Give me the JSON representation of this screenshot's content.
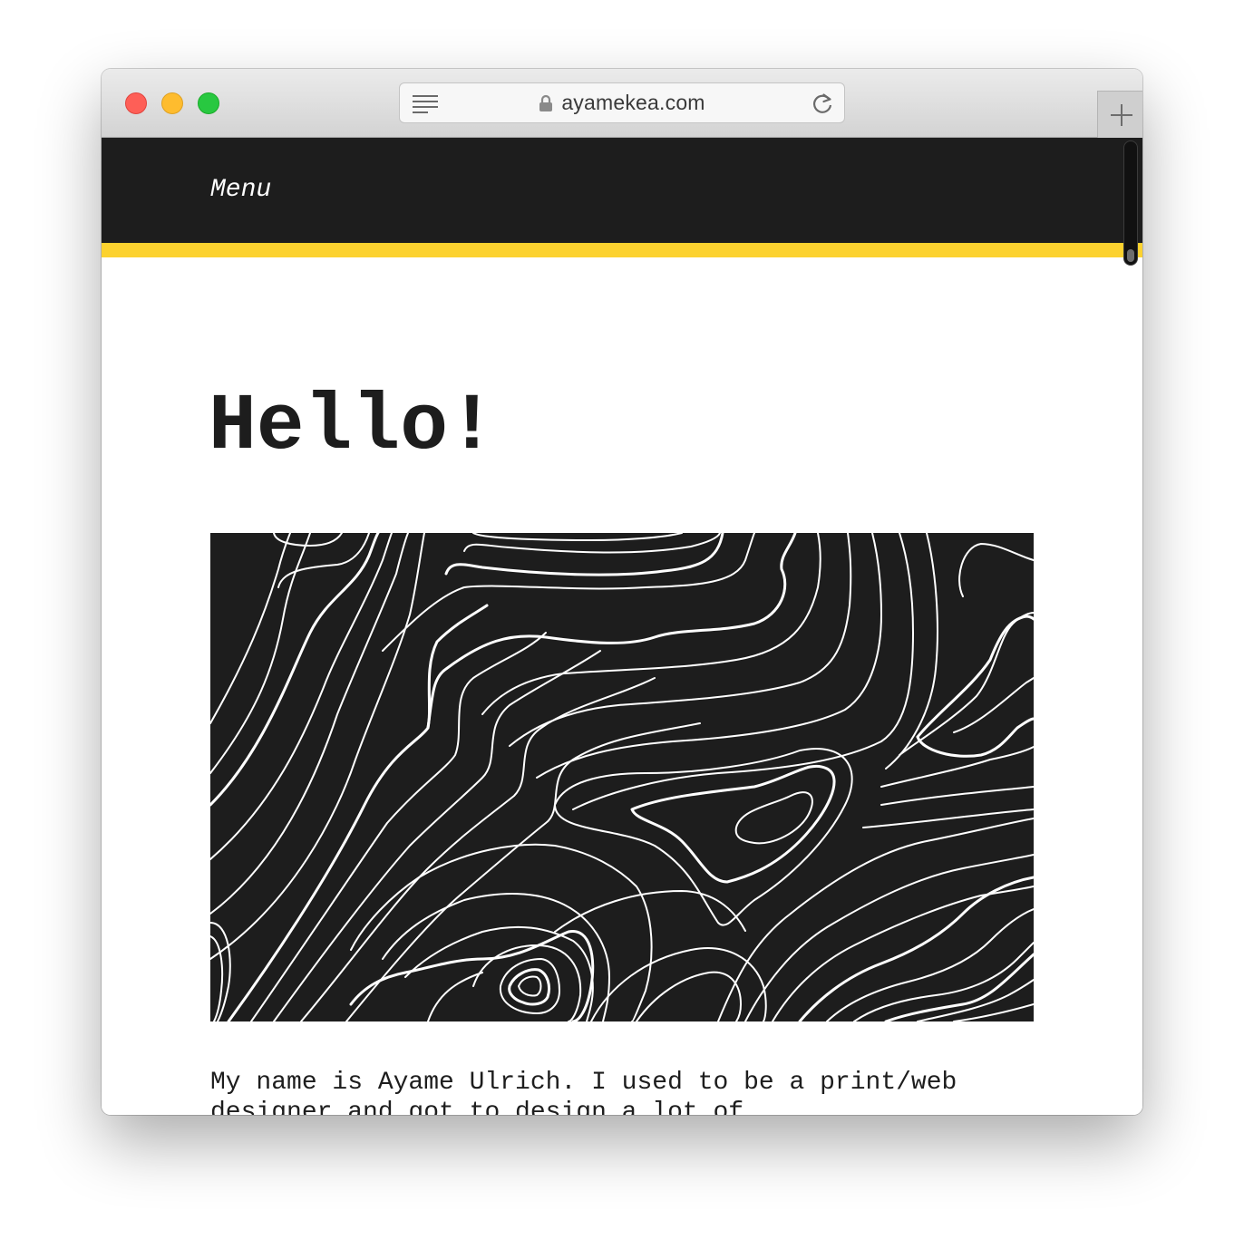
{
  "browser": {
    "url": "ayamekea.com"
  },
  "nav": {
    "menu_label": "Menu"
  },
  "main": {
    "heading": "Hello!",
    "intro": "My name is Ayame Ulrich. I used to be a print/web designer and got to design a lot of"
  },
  "colors": {
    "nav_background": "#1d1d1d",
    "accent": "#fcd22f",
    "text": "#1d1d1d"
  },
  "icons": {
    "reader": "reader-icon",
    "lock": "lock-icon",
    "reload": "reload-icon",
    "new_tab": "plus-icon"
  }
}
